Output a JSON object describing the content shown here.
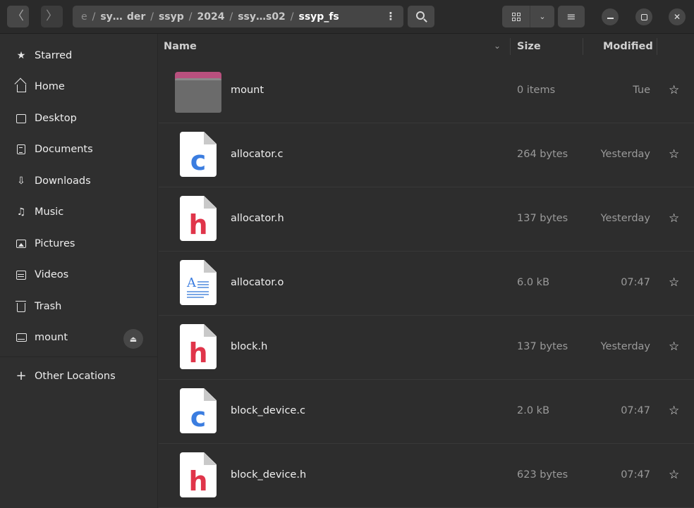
{
  "header": {
    "back_icon": "chevron-left-icon",
    "forward_icon": "chevron-right-icon",
    "breadcrumbs": [
      {
        "label": "e",
        "state": "faded"
      },
      {
        "label": "sy…",
        "state": "normal"
      },
      {
        "label": "der",
        "state": "normal"
      },
      {
        "label": "ssyp",
        "state": "normal"
      },
      {
        "label": "2024",
        "state": "normal"
      },
      {
        "label": "ssy…s02",
        "state": "normal"
      },
      {
        "label": "ssyp_fs",
        "state": "current"
      }
    ],
    "path_separator": "/",
    "path_menu_glyph": "⋮",
    "view_dropdown_glyph": "⌄",
    "menu_glyph": "≡"
  },
  "sidebar": {
    "items": [
      {
        "label": "Starred",
        "icon": "star-icon",
        "glyph": "★"
      },
      {
        "label": "Home",
        "icon": "home-icon"
      },
      {
        "label": "Desktop",
        "icon": "desktop-icon"
      },
      {
        "label": "Documents",
        "icon": "documents-icon"
      },
      {
        "label": "Downloads",
        "icon": "download-icon",
        "glyph": "⇩"
      },
      {
        "label": "Music",
        "icon": "music-icon",
        "glyph": "♫"
      },
      {
        "label": "Pictures",
        "icon": "pictures-icon"
      },
      {
        "label": "Videos",
        "icon": "videos-icon"
      },
      {
        "label": "Trash",
        "icon": "trash-icon"
      },
      {
        "label": "mount",
        "icon": "drive-icon"
      },
      {
        "label": "Other Locations",
        "icon": "plus-icon",
        "glyph": "+"
      }
    ],
    "eject_glyph": "⏏"
  },
  "columns": {
    "name": "Name",
    "size": "Size",
    "modified": "Modified",
    "sort_glyph": "⌄"
  },
  "files": [
    {
      "name": "mount",
      "size": "0 items",
      "modified": "Tue",
      "type": "folder",
      "star": "☆"
    },
    {
      "name": "allocator.c",
      "size": "264 bytes",
      "modified": "Yesterday",
      "type": "c",
      "letter": "c",
      "star": "☆"
    },
    {
      "name": "allocator.h",
      "size": "137 bytes",
      "modified": "Yesterday",
      "type": "h",
      "letter": "h",
      "star": "☆"
    },
    {
      "name": "allocator.o",
      "size": "6.0 kB",
      "modified": "07:47",
      "type": "text",
      "letter": "A",
      "star": "☆"
    },
    {
      "name": "block.h",
      "size": "137 bytes",
      "modified": "Yesterday",
      "type": "h",
      "letter": "h",
      "star": "☆"
    },
    {
      "name": "block_device.c",
      "size": "2.0 kB",
      "modified": "07:47",
      "type": "c",
      "letter": "c",
      "star": "☆"
    },
    {
      "name": "block_device.h",
      "size": "623 bytes",
      "modified": "07:47",
      "type": "h",
      "letter": "h",
      "star": "☆"
    }
  ],
  "colors": {
    "accent_c": "#3b7de0",
    "accent_h": "#e0354a",
    "folder_tab": "#b8507e"
  }
}
